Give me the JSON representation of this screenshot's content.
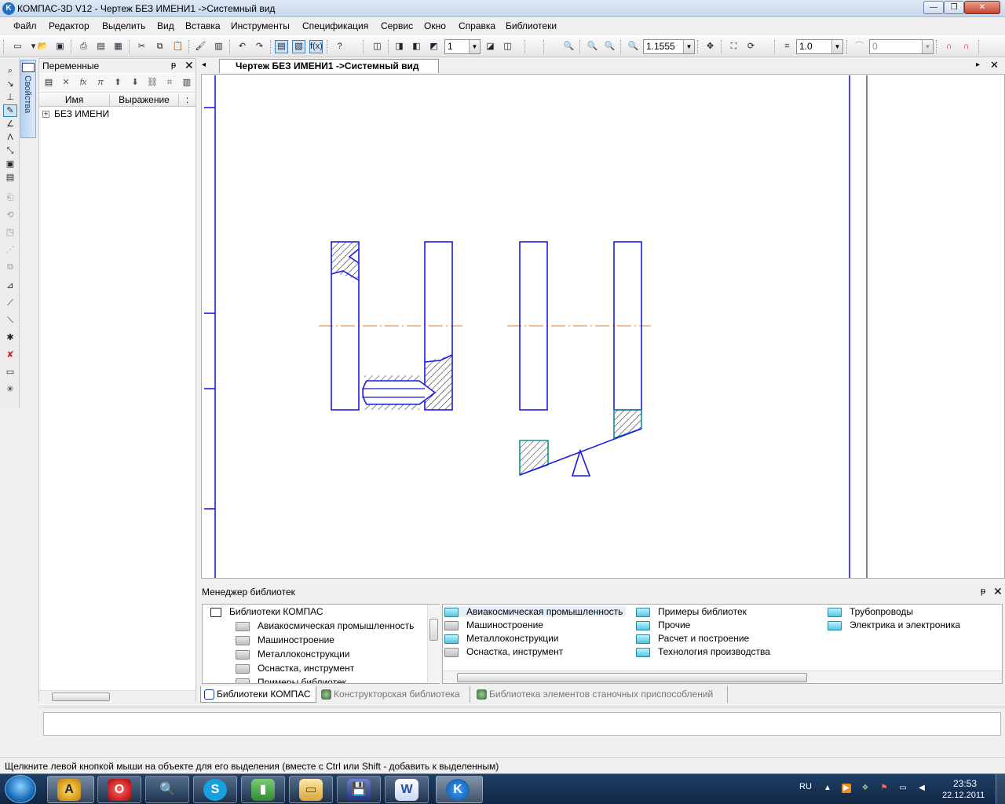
{
  "window": {
    "app_icon_glyph": "K",
    "title": "КОМПАС-3D V12 - Чертеж БЕЗ ИМЕНИ1 ->Системный вид",
    "min_glyph": "—",
    "max_glyph": "❐",
    "close_glyph": "✕"
  },
  "menu": [
    "Файл",
    "Редактор",
    "Выделить",
    "Вид",
    "Вставка",
    "Инструменты",
    "Спецификация",
    "Сервис",
    "Окно",
    "Справка",
    "Библиотеки"
  ],
  "toolbar": {
    "layer_value": "1",
    "zoom_value": "1.1555",
    "step_value": "1.0",
    "angle_value": "0",
    "fx_label": "f(x)"
  },
  "properties_tab": "Свойства",
  "variables": {
    "title": "Переменные",
    "pin": "ᵽ",
    "close": "✕",
    "col_name": "Имя",
    "col_expr": "Выражение",
    "col_more": ":",
    "plus": "+",
    "tree_item": "БЕЗ ИМЕНИ"
  },
  "document_tab": {
    "label": "Чертеж БЕЗ ИМЕНИ1 ->Системный вид",
    "left_arrow": "◂",
    "right_arrow": "▸",
    "close": "✕"
  },
  "library_manager": {
    "title": "Менеджер библиотек",
    "pin": "ᵽ",
    "close": "✕",
    "tree": [
      "Библиотеки КОМПАС",
      "Авиакосмическая промышленность",
      "Машиностроение",
      "Металлоконструкции",
      "Оснастка, инструмент",
      "Примеры библиотек"
    ],
    "list_col1": [
      "Авиакосмическая промышленность",
      "Машиностроение",
      "Металлоконструкции",
      "Оснастка, инструмент"
    ],
    "list_col2": [
      "Примеры библиотек",
      "Прочие",
      "Расчет и построение",
      "Технология производства"
    ],
    "list_col3": [
      "Трубопроводы",
      "Электрика и электроника"
    ]
  },
  "library_tabs": [
    "Библиотеки КОМПАС",
    "Конструкторская библиотека",
    "Библиотека элементов станочных приспособлений"
  ],
  "status": "Щелкните левой кнопкой мыши на объекте для его выделения (вместе с Ctrl или Shift - добавить к выделенным)",
  "taskbar": {
    "lang": "RU",
    "time": "23:53",
    "date": "22.12.2011",
    "apps": [
      "А",
      "O",
      "🔍",
      "S",
      "▮",
      "▭",
      "💾",
      "W",
      "K"
    ]
  },
  "colors": {
    "drawing_line": "#1a1ae6",
    "axis_line": "#e07a2a",
    "hatch": "#000000",
    "highlight": "#12908e"
  }
}
